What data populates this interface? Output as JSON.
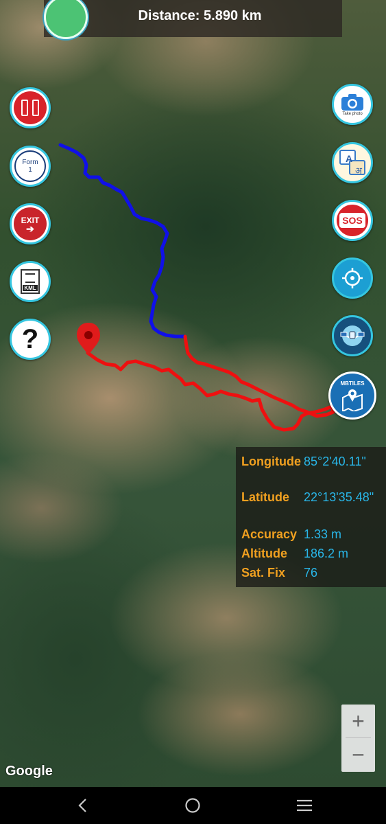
{
  "header": {
    "distance_text": "Distance: 5.890 km"
  },
  "left_buttons": {
    "form_title": "Form",
    "form_number": "1",
    "exit_label": "EXIT",
    "kml_label": "KML",
    "help_label": "?"
  },
  "right_buttons": {
    "camera_label": "Take photo",
    "translate_latin": "A",
    "translate_devanagari": "अ",
    "sos_label": "SOS",
    "mbtiles_label": "MBTILES"
  },
  "info": {
    "longitude_label": "Longitude",
    "longitude_value": "85°2'40.11\"",
    "latitude_label": "Latitude",
    "latitude_value": "22°13'35.48\"",
    "accuracy_label": "Accuracy",
    "accuracy_value": "1.33 m",
    "altitude_label": "Altitude",
    "altitude_value": "186.2 m",
    "satfix_label": "Sat. Fix",
    "satfix_value": "76"
  },
  "map": {
    "attribution": "Google",
    "zoom_in": "+",
    "zoom_out": "−"
  },
  "colors": {
    "track_blue": "#1010e8",
    "track_red": "#ee1010",
    "marker_red": "#e01b1b",
    "info_key": "#f0a020",
    "info_value": "#29b6e8"
  }
}
